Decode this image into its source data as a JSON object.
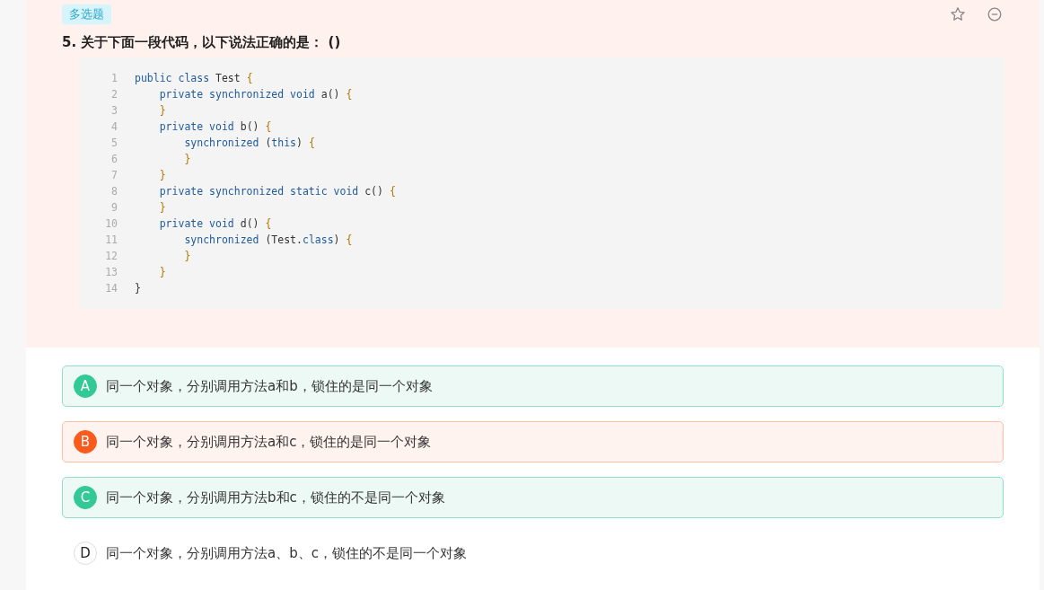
{
  "question": {
    "type_tag": "多选题",
    "number": "5.",
    "title": "关于下面一段代码，以下说法正确的是： ()"
  },
  "code": [
    {
      "num": "1",
      "tokens": [
        {
          "t": "public class",
          "kind": "keyword"
        },
        {
          "t": " Test ",
          "kind": "plain"
        },
        {
          "t": "{",
          "kind": "brace"
        }
      ]
    },
    {
      "num": "2",
      "tokens": [
        {
          "t": "    private synchronized void",
          "kind": "keyword"
        },
        {
          "t": " a() ",
          "kind": "plain"
        },
        {
          "t": "{",
          "kind": "brace"
        }
      ]
    },
    {
      "num": "3",
      "tokens": [
        {
          "t": "    }",
          "kind": "brace"
        }
      ]
    },
    {
      "num": "4",
      "tokens": [
        {
          "t": "    private void",
          "kind": "keyword"
        },
        {
          "t": " b() ",
          "kind": "plain"
        },
        {
          "t": "{",
          "kind": "brace"
        }
      ]
    },
    {
      "num": "5",
      "tokens": [
        {
          "t": "        synchronized",
          "kind": "keyword"
        },
        {
          "t": " (",
          "kind": "plain"
        },
        {
          "t": "this",
          "kind": "keyword"
        },
        {
          "t": ") ",
          "kind": "plain"
        },
        {
          "t": "{",
          "kind": "brace"
        }
      ]
    },
    {
      "num": "6",
      "tokens": [
        {
          "t": "        }",
          "kind": "brace"
        }
      ]
    },
    {
      "num": "7",
      "tokens": [
        {
          "t": "    }",
          "kind": "brace"
        }
      ]
    },
    {
      "num": "8",
      "tokens": [
        {
          "t": "    private synchronized static void",
          "kind": "keyword"
        },
        {
          "t": " c() ",
          "kind": "plain"
        },
        {
          "t": "{",
          "kind": "brace"
        }
      ]
    },
    {
      "num": "9",
      "tokens": [
        {
          "t": "    }",
          "kind": "brace"
        }
      ]
    },
    {
      "num": "10",
      "tokens": [
        {
          "t": "    private void",
          "kind": "keyword"
        },
        {
          "t": " d() ",
          "kind": "plain"
        },
        {
          "t": "{",
          "kind": "brace"
        }
      ]
    },
    {
      "num": "11",
      "tokens": [
        {
          "t": "        synchronized",
          "kind": "keyword"
        },
        {
          "t": " (Test.",
          "kind": "plain"
        },
        {
          "t": "class",
          "kind": "keyword"
        },
        {
          "t": ") ",
          "kind": "plain"
        },
        {
          "t": "{",
          "kind": "brace"
        }
      ]
    },
    {
      "num": "12",
      "tokens": [
        {
          "t": "        }",
          "kind": "brace"
        }
      ]
    },
    {
      "num": "13",
      "tokens": [
        {
          "t": "    }",
          "kind": "brace"
        }
      ]
    },
    {
      "num": "14",
      "tokens": [
        {
          "t": "}",
          "kind": "plain"
        }
      ]
    }
  ],
  "options": [
    {
      "letter": "A",
      "text": "同一个对象，分别调用方法a和b，锁住的是同一个对象",
      "kind": "correct"
    },
    {
      "letter": "B",
      "text": "同一个对象，分别调用方法a和c，锁住的是同一个对象",
      "kind": "wrong"
    },
    {
      "letter": "C",
      "text": "同一个对象，分别调用方法b和c，锁住的不是同一个对象",
      "kind": "correct"
    },
    {
      "letter": "D",
      "text": "同一个对象，分别调用方法a、b、c，锁住的不是同一个对象",
      "kind": "plain"
    }
  ]
}
